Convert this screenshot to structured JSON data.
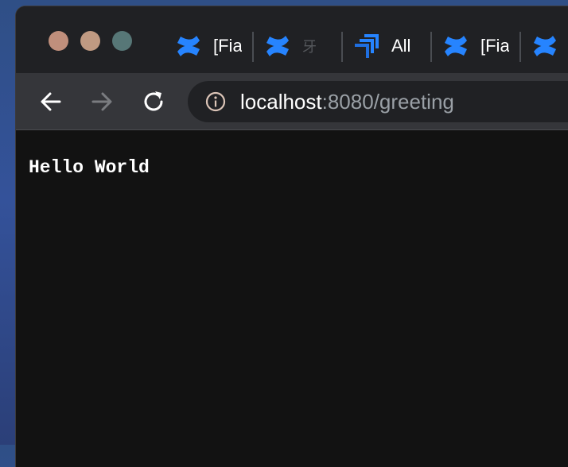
{
  "browser": {
    "tabs": [
      {
        "icon": "confluence-icon",
        "label": "[Fia"
      },
      {
        "icon": "confluence-icon",
        "label": "牙"
      },
      {
        "icon": "jira-icon",
        "label": "All"
      },
      {
        "icon": "confluence-icon",
        "label": "[Fia"
      },
      {
        "icon": "confluence-icon",
        "label": ""
      }
    ],
    "address": {
      "host": "localhost",
      "rest": ":8080/greeting"
    }
  },
  "page": {
    "text": "Hello World"
  },
  "colors": {
    "confluence_blue": "#2684ff",
    "titlebar": "#202124",
    "toolbar": "#35363a",
    "page_background": "#121212"
  }
}
